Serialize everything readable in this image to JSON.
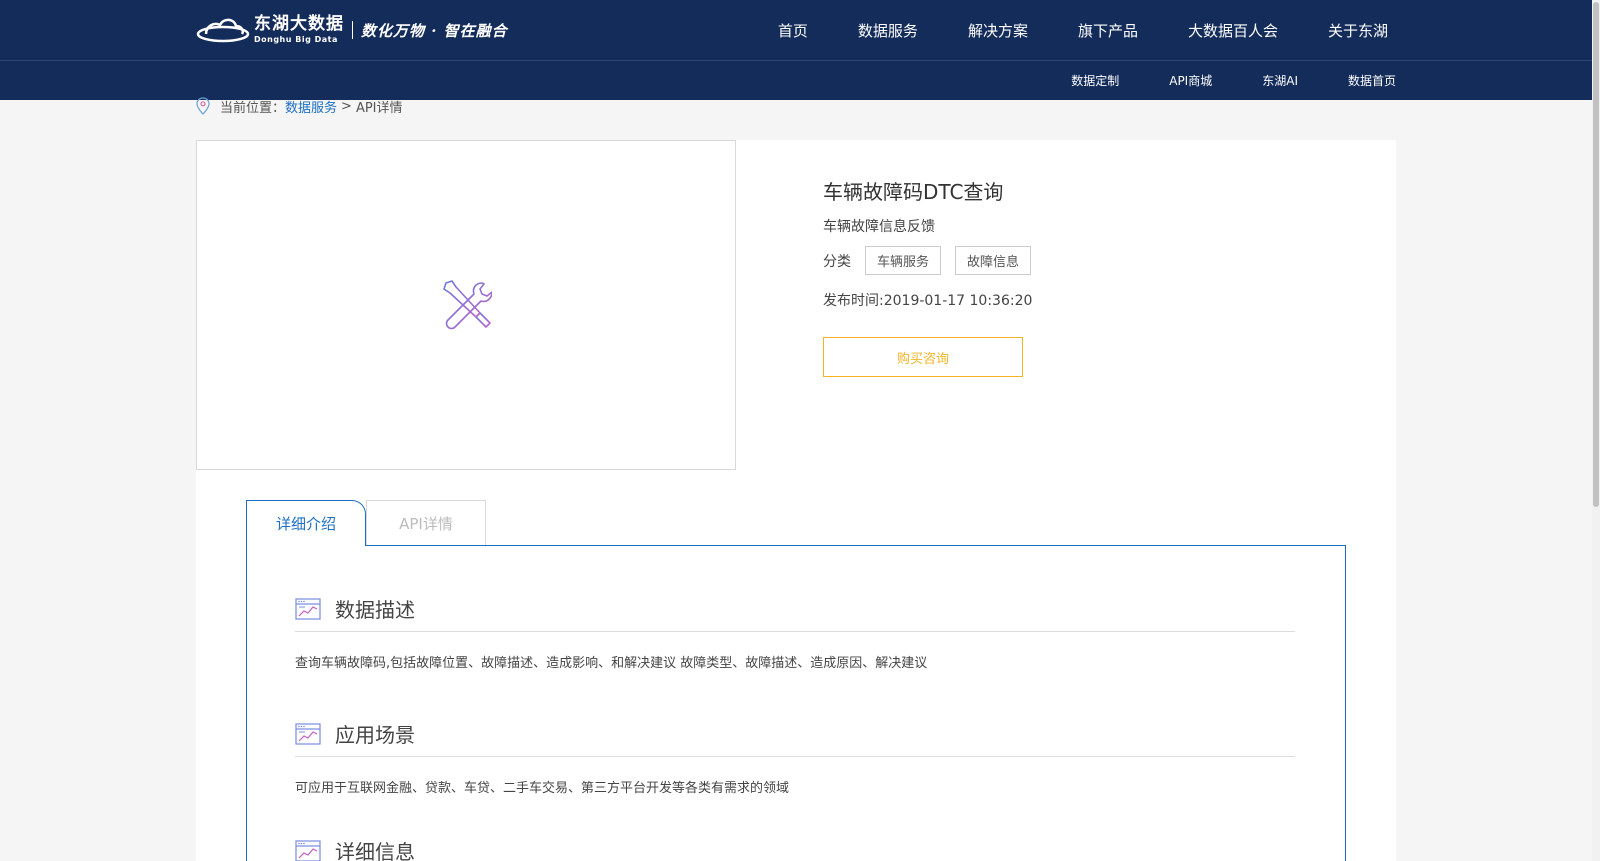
{
  "header": {
    "logo_cn": "东湖大数据",
    "logo_en": "Donghu Big Data",
    "slogan": "数化万物 · 智在融合",
    "main_nav": [
      "首页",
      "数据服务",
      "解决方案",
      "旗下产品",
      "大数据百人会",
      "关于东湖"
    ],
    "sub_nav": [
      "数据定制",
      "API商城",
      "东湖AI",
      "数据首页"
    ]
  },
  "breadcrumb": {
    "prefix": "当前位置：",
    "link": "数据服务",
    "separator": ">",
    "current": "API详情"
  },
  "product": {
    "title": "车辆故障码DTC查询",
    "subtitle": "车辆故障信息反馈",
    "category_label": "分类",
    "tags": [
      "车辆服务",
      "故障信息"
    ],
    "publish_time": "发布时间:2019-01-17 10:36:20",
    "buy_label": "购买咨询",
    "image_icon": "tools-icon"
  },
  "tabs": {
    "detail": "详细介绍",
    "api": "API详情"
  },
  "sections": [
    {
      "title": "数据描述",
      "text": "查询车辆故障码,包括故障位置、故障描述、造成影响、和解决建议 故障类型、故障描述、造成原因、解决建议"
    },
    {
      "title": "应用场景",
      "text": "可应用于互联网金融、贷款、车贷、二手车交易、第三方平台开发等各类有需求的领域"
    },
    {
      "title": "详细信息",
      "text": ""
    }
  ],
  "colors": {
    "header_bg": "#142c5a",
    "link_blue": "#1c6fc4",
    "buy_orange": "#f5b325"
  }
}
